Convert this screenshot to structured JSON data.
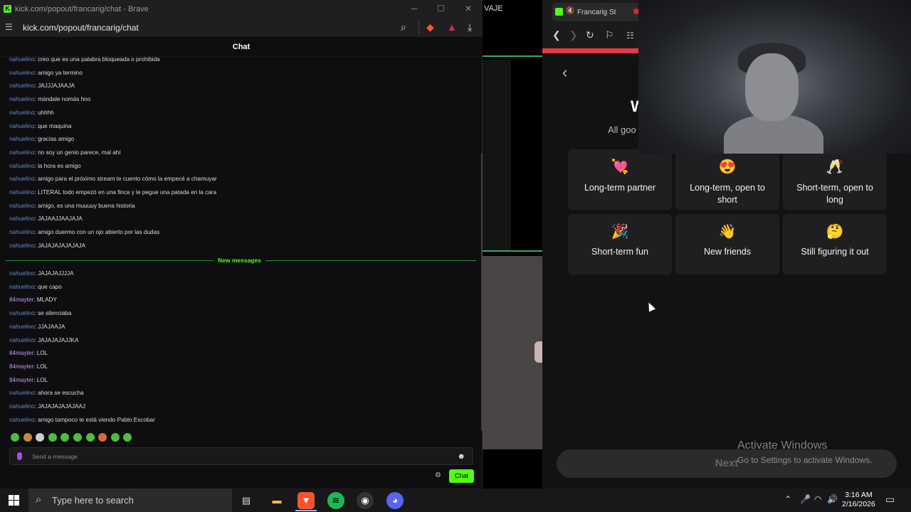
{
  "left_window": {
    "title": "kick.com/popout/francarig/chat - Brave",
    "controls": {
      "minimize": "─",
      "maximize": "☐",
      "close": "✕"
    },
    "url": "kick.com/popout/francarig/chat",
    "chat_header": "Chat",
    "messages_before": [
      {
        "user": "nahuelino",
        "text": "creo que es una palabra bloqueada o prohibida"
      },
      {
        "user": "nahuelino",
        "text": "amigo ya termino"
      },
      {
        "user": "nahuelino",
        "text": "JAJJJAJAAJA"
      },
      {
        "user": "nahuelino",
        "text": "mándale nomás hno"
      },
      {
        "user": "nahuelino",
        "text": "uhhhh"
      },
      {
        "user": "nahuelino",
        "text": "que maquina"
      },
      {
        "user": "nahuelino",
        "text": "gracias amigo"
      },
      {
        "user": "nahuelino",
        "text": "no soy un genio parece, mal ahí"
      },
      {
        "user": "nahuelino",
        "text": "la hora es amigo"
      },
      {
        "user": "nahuelino",
        "text": "amigo para el próximo stream te cuento cómo la empecé a chamuyar"
      },
      {
        "user": "nahuelino",
        "text": "LITERAL todo empezó en una finca y le pegue una patada en la cara"
      },
      {
        "user": "nahuelino",
        "text": "amigo, es una muuuuy buena historia"
      },
      {
        "user": "nahuelino",
        "text": "JAJAAJJAAJAJA"
      },
      {
        "user": "nahuelino",
        "text": "amigo duermo con un ojo abierto por las dudas"
      },
      {
        "user": "nahuelino",
        "text": "JAJAJAJAJAJAJA"
      }
    ],
    "new_messages_label": "New messages",
    "messages_after": [
      {
        "user": "nahuelino",
        "text": "JAJAJAJJJJA"
      },
      {
        "user": "nahuelino",
        "text": "que capo"
      },
      {
        "user": "84mayter",
        "text": "MLADY"
      },
      {
        "user": "nahuelino",
        "text": "se silenciaba"
      },
      {
        "user": "nahuelino",
        "text": "JJAJAAJA"
      },
      {
        "user": "nahuelino",
        "text": "JAJAJAJAJJKA"
      },
      {
        "user": "84mayter",
        "text": "LOL"
      },
      {
        "user": "84mayter",
        "text": "LOL"
      },
      {
        "user": "84mayter",
        "text": "LOL"
      },
      {
        "user": "nahuelino",
        "text": "ahora se escucha"
      },
      {
        "user": "nahuelino",
        "text": "JAJAJAJAJAJAAJ"
      },
      {
        "user": "nahuelino",
        "text": "amigo tampoco te está viendo Pablo Escobar"
      }
    ],
    "input_placeholder": "Send a message",
    "send_button": "Chat",
    "colors": {
      "accent": "#53fc18",
      "username": "#5b8dd6",
      "username_alt": "#c79bff"
    }
  },
  "middle_window": {
    "partial_title": "VAJE"
  },
  "right_window": {
    "tab_title": "Francarig St",
    "heading_partial": "W",
    "subheading_partial": "All goo",
    "options": [
      {
        "emoji": "💘",
        "label": "Long-term partner"
      },
      {
        "emoji": "😍",
        "label": "Long-term, open to short"
      },
      {
        "emoji": "🥂",
        "label": "Short-term, open to long"
      },
      {
        "emoji": "🎉",
        "label": "Short-term fun"
      },
      {
        "emoji": "👋",
        "label": "New friends"
      },
      {
        "emoji": "🤔",
        "label": "Still figuring it out"
      }
    ],
    "next_button": "Next",
    "progress_fraction": 0.26,
    "colors": {
      "progress": "#e63946",
      "card": "#1f1f21"
    }
  },
  "watermark": {
    "line1": "Activate Windows",
    "line2": "Go to Settings to activate Windows."
  },
  "taskbar": {
    "search_placeholder": "Type here to search",
    "time": "3:16 AM",
    "date": "2/16/2026",
    "apps": [
      "task-view",
      "file-explorer",
      "brave",
      "spotify",
      "obs",
      "discord"
    ]
  }
}
